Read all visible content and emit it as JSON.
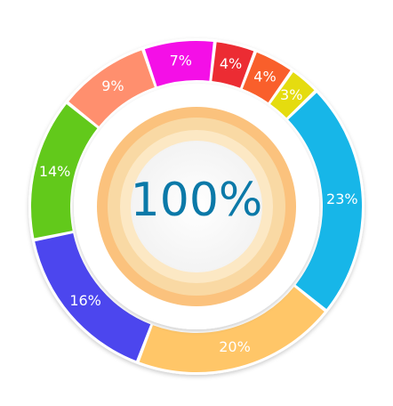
{
  "chart_data": {
    "type": "pie",
    "style": "segmented-ring",
    "categories": [
      "23%",
      "20%",
      "16%",
      "14%",
      "9%",
      "7%",
      "4%",
      "4%",
      "3%"
    ],
    "values": [
      23,
      20,
      16,
      14,
      9,
      7,
      4,
      4,
      3
    ],
    "colors": [
      "#17b6e8",
      "#ffc668",
      "#4c46ee",
      "#62c91b",
      "#ff8f6e",
      "#f40fe7",
      "#ec2c33",
      "#f95f2b",
      "#e5dc0f"
    ],
    "center": {
      "label": "100%",
      "color": "#0b79a8",
      "ring_colors": [
        "#fbc27d",
        "#f9d9a4",
        "#fce8c4",
        "#ffffff"
      ]
    }
  }
}
